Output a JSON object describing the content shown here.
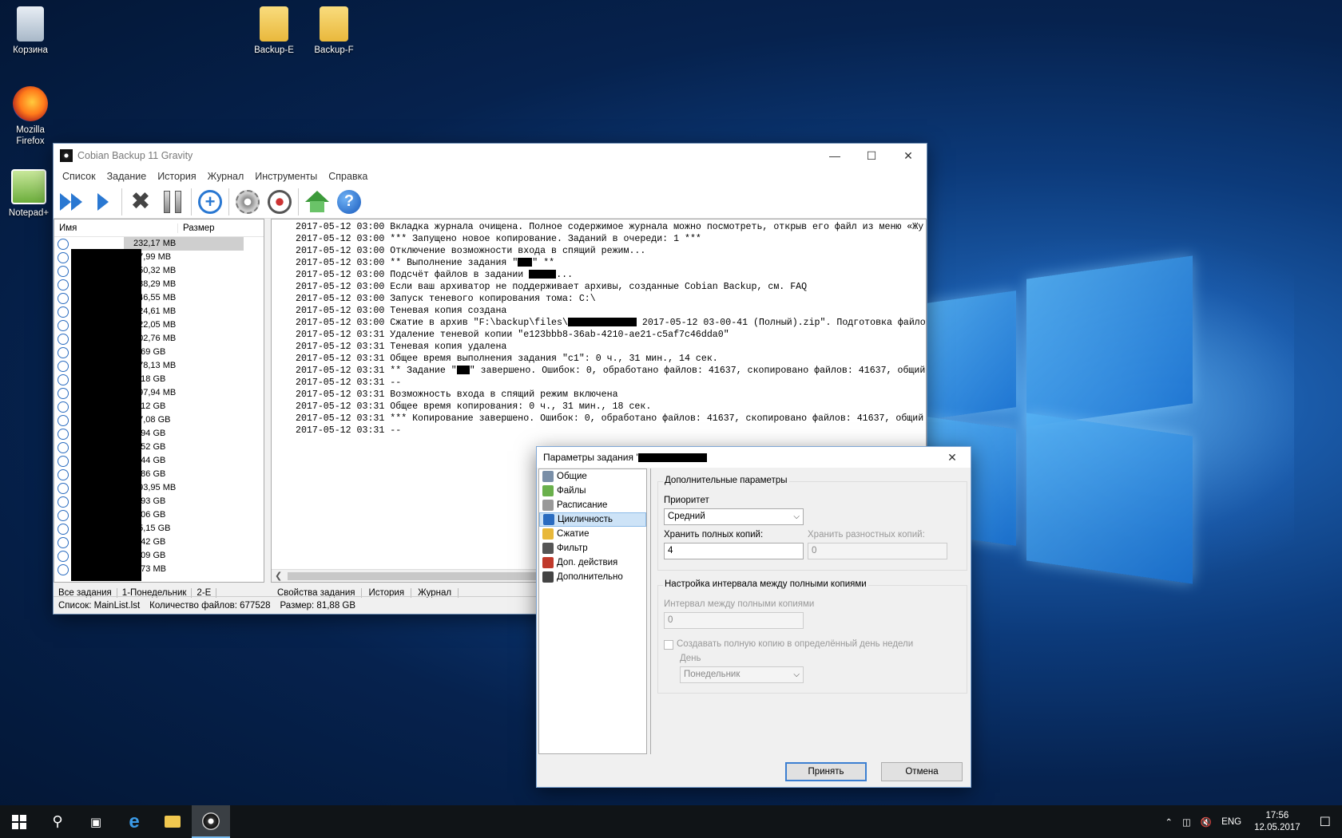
{
  "desktop": {
    "icons": [
      {
        "label": "Корзина"
      },
      {
        "label": "Backup-E"
      },
      {
        "label": "Backup-F"
      },
      {
        "label": "Mozilla Firefox"
      },
      {
        "label": "Notepad+"
      }
    ]
  },
  "main_window": {
    "title": "Cobian Backup 11 Gravity",
    "menu": [
      "Список",
      "Задание",
      "История",
      "Журнал",
      "Инструменты",
      "Справка"
    ],
    "toolbar_icons": [
      "run-all-icon",
      "run-icon",
      "cancel-icon",
      "pause-icon",
      "add-task-icon",
      "settings-icon",
      "remote-icon",
      "home-icon",
      "help-icon"
    ],
    "task_list": {
      "col_name": "Имя",
      "col_size": "Размер",
      "sizes": [
        "232,17 MB",
        "57,99 MB",
        "450,32 MB",
        "188,29 MB",
        "146,55 MB",
        "424,61 MB",
        "722,05 MB",
        "602,76 MB",
        "2,69 GB",
        "178,13 MB",
        "1,18 GB",
        "197,94 MB",
        "9,12 GB",
        "17,08 GB",
        "1,94 GB",
        "2,52 GB",
        "2,44 GB",
        "4,86 GB",
        "293,95 MB",
        "3,93 GB",
        "7,06 GB",
        "15,15 GB",
        "5,42 GB",
        "5,09 GB",
        "1,73 MB"
      ]
    },
    "left_tabs": [
      "Все задания",
      "1-Понедельник",
      "2-Е"
    ],
    "right_tabs": [
      "Свойства задания",
      "История",
      "Журнал"
    ],
    "log": [
      "2017-05-12 03:00 Вкладка журнала очищена. Полное содержимое журнала можно посмотреть, открыв его файл из меню «Жу",
      "2017-05-12 03:00 *** Запущено новое копирование. Заданий в очереди: 1 ***",
      "2017-05-12 03:00 Отключение возможности входа в спящий режим...",
      "2017-05-12 03:00 ** Выполнение задания \"",
      "2017-05-12 03:00 Подсчёт файлов в задании ",
      "2017-05-12 03:00 Если ваш архиватор не поддерживает архивы, созданные Cobian Backup, см. FAQ",
      "2017-05-12 03:00 Запуск теневого копирования тома: C:\\",
      "2017-05-12 03:00 Теневая копия создана",
      "2017-05-12 03:00 Сжатие в архив \"F:\\backup\\files\\",
      "2017-05-12 03:31 Удаление теневой копии \"e123bbb8-36ab-4210-ae21-c5af7c46dda0\"",
      "2017-05-12 03:31 Теневая копия удалена",
      "2017-05-12 03:31 Общее время выполнения задания \"c1\": 0 ч., 31 мин., 14 сек.",
      "2017-05-12 03:31 ** Задание \"",
      "2017-05-12 03:31 --",
      "2017-05-12 03:31 Возможность входа в спящий режим включена",
      "2017-05-12 03:31 Общее время копирования: 0 ч., 31 мин., 18 сек.",
      "2017-05-12 03:31 *** Копирование завершено. Ошибок: 0, обработано файлов: 41637, скопировано файлов: 41637, общий",
      "2017-05-12 03:31 --"
    ],
    "log_tails": {
      "line4": "\" **",
      "line5": "...",
      "line9": " 2017-05-12 03-00-41 (Полный).zip\". Подготовка файло",
      "line13": "\" завершено. Ошибок: 0, обработано файлов: 41637, скопировано файлов: 41637, общий"
    },
    "status": {
      "list": "Список: MainList.lst",
      "files": "Количество файлов: 677528",
      "size": "Размер: 81,88 GB"
    }
  },
  "dialog": {
    "title": "Параметры задания '",
    "nav": [
      "Общие",
      "Файлы",
      "Расписание",
      "Цикличность",
      "Сжатие",
      "Фильтр",
      "Доп. действия",
      "Дополнительно"
    ],
    "selected_nav": "Цикличность",
    "group1_title": "Дополнительные параметры",
    "priority_label": "Приоритет",
    "priority_value": "Средний",
    "full_copies_label": "Хранить полных копий:",
    "full_copies_value": "4",
    "diff_copies_label": "Хранить разностных копий:",
    "diff_copies_value": "0",
    "group2_title": "Настройка интервала между полными копиями",
    "interval_label": "Интервал между полными копиями",
    "interval_value": "0",
    "weekday_check_label": "Создавать полную копию в определённый день недели",
    "day_label": "День",
    "day_value": "Понедельник",
    "ok_label": "Принять",
    "cancel_label": "Отмена"
  },
  "taskbar": {
    "lang": "ENG",
    "time": "17:56",
    "date": "12.05.2017"
  }
}
